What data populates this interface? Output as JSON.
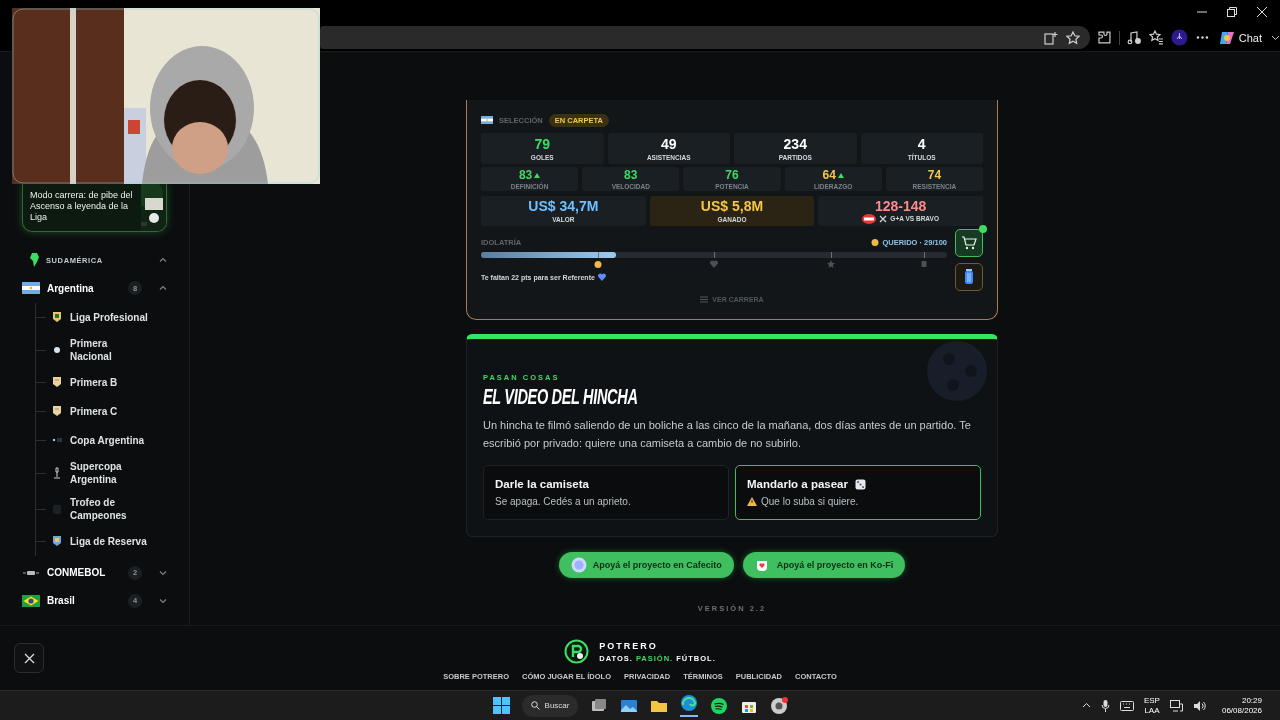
{
  "browser": {
    "chat_label": "Chat"
  },
  "sidebar": {
    "promo_text": "Modo carrera: de pibe del Ascenso a leyenda de la Liga",
    "tree": [
      {
        "label": "SUDAMÉRICA",
        "kind": "region",
        "expanded": true,
        "children": [
          {
            "label": "Argentina",
            "kind": "country",
            "count": "8",
            "expanded": true,
            "children": [
              {
                "label": "Liga Profesional"
              },
              {
                "label": "Primera Nacional"
              },
              {
                "label": "Primera B"
              },
              {
                "label": "Primera C"
              },
              {
                "label": "Copa Argentina"
              },
              {
                "label": "Supercopa Argentina"
              },
              {
                "label": "Trofeo de Campeones"
              },
              {
                "label": "Liga de Reserva"
              }
            ]
          },
          {
            "label": "CONMEBOL",
            "kind": "confederation",
            "count": "2",
            "expanded": false
          },
          {
            "label": "Brasil",
            "kind": "country",
            "count": "4",
            "expanded": false
          }
        ]
      }
    ]
  },
  "career": {
    "team_label": "SELECCIÓN",
    "status": "EN CARPETA",
    "stats": [
      {
        "value": "79",
        "label": "GOLES",
        "color": "#3ddc62"
      },
      {
        "value": "49",
        "label": "ASISTENCIAS",
        "color": "#ffffff"
      },
      {
        "value": "234",
        "label": "PARTIDOS",
        "color": "#ffffff"
      },
      {
        "value": "4",
        "label": "TÍTULOS",
        "color": "#ffffff"
      }
    ],
    "attributes": [
      {
        "value": "83",
        "label": "DEFINICIÓN",
        "rising": true,
        "color": "#3ddc62"
      },
      {
        "value": "83",
        "label": "VELOCIDAD",
        "rising": false,
        "color": "#3ddc62"
      },
      {
        "value": "76",
        "label": "POTENCIA",
        "rising": false,
        "color": "#3ddc62"
      },
      {
        "value": "64",
        "label": "LIDERAZGO",
        "rising": true,
        "color": "#f2c94c"
      },
      {
        "value": "74",
        "label": "RESISTENCIA",
        "rising": false,
        "color": "#f2c94c"
      }
    ],
    "finances": [
      {
        "kind": "value",
        "value": "US$ 34,7M",
        "label": "VALOR"
      },
      {
        "kind": "earned",
        "value": "US$ 5,8M",
        "label": "GANADO"
      },
      {
        "kind": "rivalry",
        "value": "128-148",
        "label": "G+A VS BRAVO"
      }
    ],
    "idolatry": {
      "label": "IDOLATRÍA",
      "status": "QUERIDO · 29/100",
      "level": 0.29,
      "hint": "Te faltan 22 pts para ser Referente"
    },
    "career_link": "VER CARRERA",
    "shop_notification": true
  },
  "event": {
    "eyebrow": "PASAN COSAS",
    "title": "EL VIDEO DEL HINCHA",
    "body": "Un hincha te filmó saliendo de un boliche a las cinco de la mañana, dos días antes de un partido. Te escribió por privado: quiere una camiseta a cambio de no subirlo.",
    "options": [
      {
        "title": "Darle la camiseta",
        "note": "Se apaga. Cedés a un aprieto.",
        "risky": false,
        "random": false,
        "selected": false
      },
      {
        "title": "Mandarlo a pasear",
        "note": "Que lo suba si quiere.",
        "risky": true,
        "random": true,
        "selected": true
      }
    ]
  },
  "support_buttons": [
    {
      "label": "Apoyá el proyecto en Cafecito"
    },
    {
      "label": "Apoyá el proyecto en Ko-Fi"
    }
  ],
  "version": "VERSIÓN 2.2",
  "footer": {
    "brand": "POTRERO",
    "tagline": [
      {
        "word": "DATOS.",
        "highlight": false
      },
      {
        "word": "PASIÓN.",
        "highlight": true
      },
      {
        "word": "FÚTBOL.",
        "highlight": false
      }
    ],
    "links": [
      "SOBRE POTRERO",
      "CÓMO JUGAR EL ÍDOLO",
      "PRIVACIDAD",
      "TÉRMINOS",
      "PUBLICIDAD",
      "CONTACTO"
    ]
  },
  "taskbar": {
    "search": "Buscar",
    "language": "ESP",
    "layout": "LAA",
    "time": "20:29",
    "date": "06/08/2026"
  }
}
